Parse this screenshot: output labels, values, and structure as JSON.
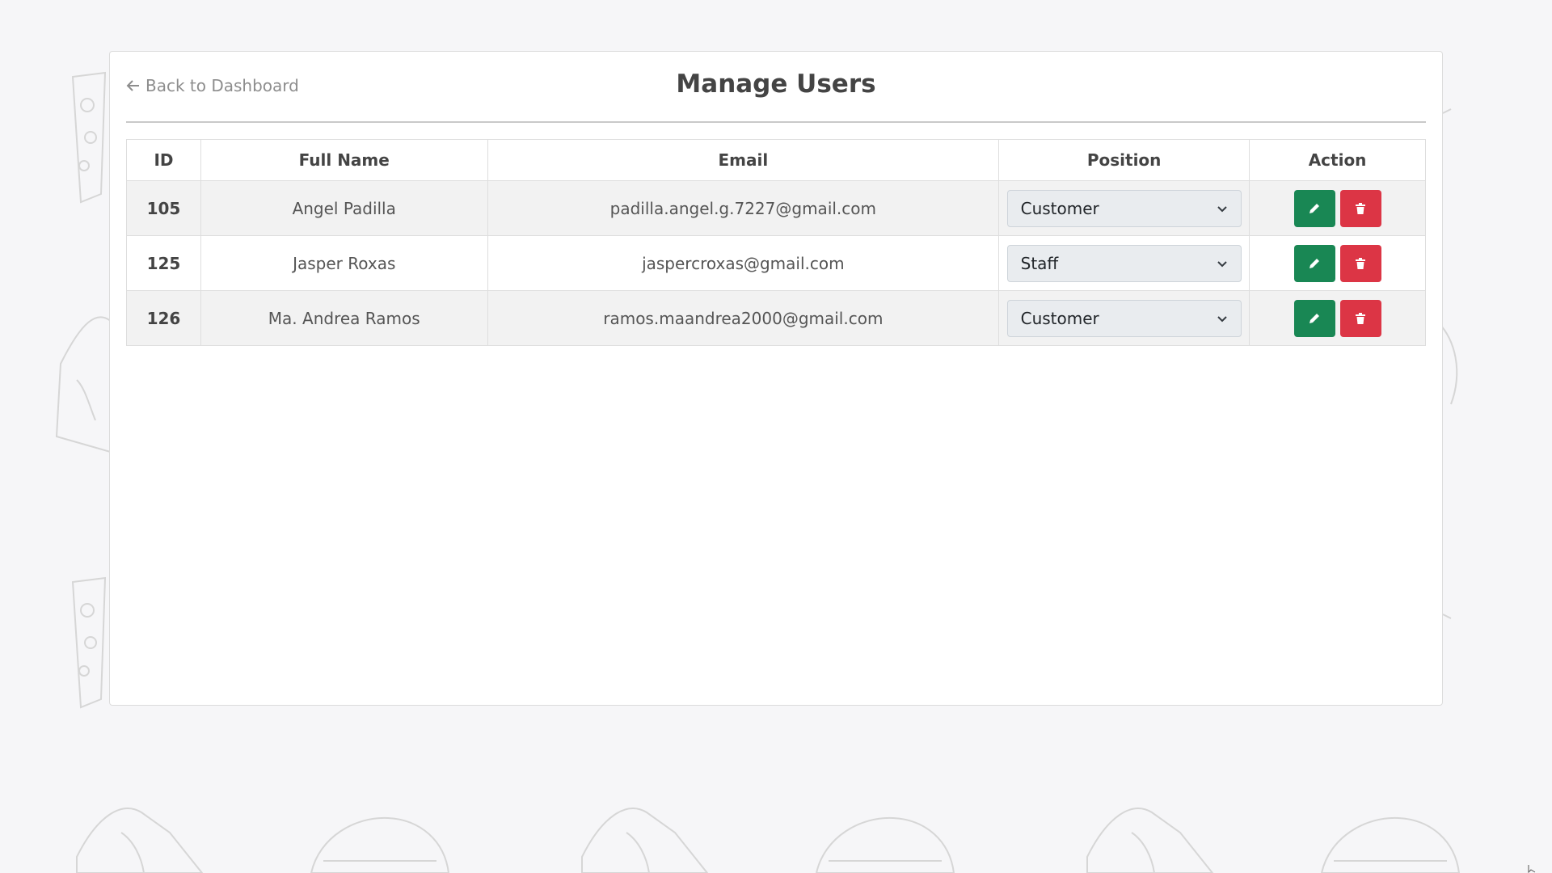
{
  "header": {
    "back_label": "Back to Dashboard",
    "back_icon": "arrow-left-icon",
    "title": "Manage Users"
  },
  "table": {
    "columns": [
      "ID",
      "Full Name",
      "Email",
      "Position",
      "Action"
    ],
    "rows": [
      {
        "id": "105",
        "name": "Angel Padilla",
        "email": "padilla.angel.g.7227@gmail.com",
        "position": "Customer"
      },
      {
        "id": "125",
        "name": "Jasper Roxas",
        "email": "jaspercroxas@gmail.com",
        "position": "Staff"
      },
      {
        "id": "126",
        "name": "Ma. Andrea Ramos",
        "email": "ramos.maandrea2000@gmail.com",
        "position": "Customer"
      }
    ]
  },
  "icons": {
    "edit": "pencil-icon",
    "delete": "trash-icon",
    "dropdown": "chevron-down-icon"
  },
  "colors": {
    "edit_button": "#198754",
    "delete_button": "#dc3545",
    "page_background": "#f6f6f8"
  }
}
